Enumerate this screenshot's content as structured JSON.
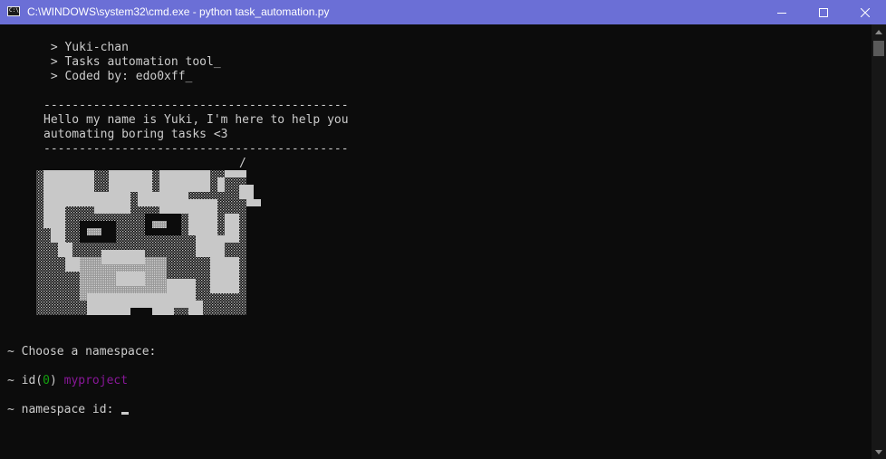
{
  "window": {
    "title": "C:\\WINDOWS\\system32\\cmd.exe - python  task_automation.py",
    "icon": "cmd-icon",
    "icon_text": "C:\\"
  },
  "banner": {
    "line1": " > Yuki-chan",
    "line2": " > Tasks automation tool_",
    "line3": " > Coded by: edo0xff_"
  },
  "greeting": {
    "divider_top": "-------------------------------------------",
    "message1": "Hello my name is Yuki, I'm here to help you",
    "message2": "automating boring tasks <3",
    "divider_bottom": "-------------------------------------------",
    "slash": "/"
  },
  "prompt": {
    "choose": "~ Choose a namespace:",
    "item_prefix": "~ id(",
    "item_id": "0",
    "item_suffix": ")",
    "item_name": "myproject",
    "input_label": "~ namespace id:"
  },
  "colors": {
    "background": "#0c0c0c",
    "text": "#cccccc",
    "titlebar": "#6b6fd6",
    "id_green": "#13a10e",
    "project_purple": "#881798"
  }
}
